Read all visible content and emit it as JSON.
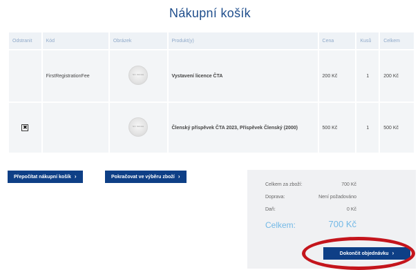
{
  "page_title": "Nákupní košík",
  "table": {
    "headers": {
      "remove": "Odstranit",
      "code": "Kód",
      "image": "Obrázek",
      "product": "Produkt(y)",
      "price": "Cena",
      "qty": "Kusů",
      "total": "Celkem"
    },
    "rows": [
      {
        "code": "FirstRegistrationFee",
        "image_text": "NO IMAGE",
        "product": "Vystavení licence ČTA",
        "price": "200 Kč",
        "qty": "1",
        "total": "200 Kč",
        "has_remove": false
      },
      {
        "code": "",
        "image_text": "NO IMAGE",
        "product": "Členský příspěvek ČTA 2023, Příspěvek Členský (2000)",
        "price": "500 Kč",
        "qty": "1",
        "total": "500 Kč",
        "has_remove": true,
        "remove_mark": "✖"
      }
    ]
  },
  "buttons": {
    "recalculate": "Přepočítat nákupní košík",
    "continue": "Pokračovat ve výběru zboží",
    "checkout": "Dokončit objednávku",
    "chevron": "›"
  },
  "summary": {
    "subtotal_label": "Celkem za zboží:",
    "subtotal_value": "700 Kč",
    "shipping_label": "Doprava:",
    "shipping_value": "Není požadováno",
    "tax_label": "Daň:",
    "tax_value": "0 Kč",
    "total_label": "Celkem:",
    "total_value": "700 Kč"
  },
  "colors": {
    "brand_blue": "#0e3f86",
    "title_blue": "#1f4e8c",
    "accent_light_blue": "#73b9e6",
    "highlight_red": "#c4151c"
  }
}
